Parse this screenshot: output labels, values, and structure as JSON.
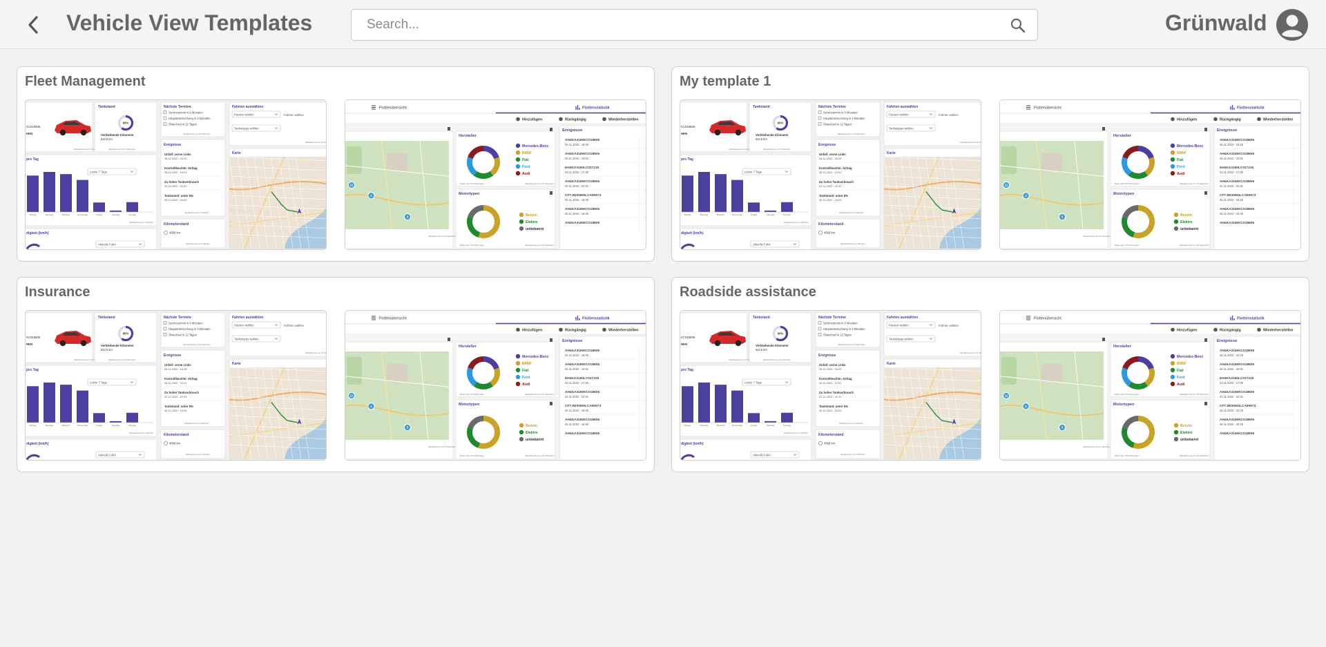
{
  "header": {
    "title": "Vehicle View Templates",
    "search_placeholder": "Search...",
    "org_name": "Grünwald"
  },
  "colors": {
    "accent": "#4b3fa0",
    "header_bg": "#f4f4f4"
  },
  "icons": {
    "back": "chevron-left-icon",
    "search": "search-icon",
    "avatar": "account-circle-icon"
  },
  "templates": [
    {
      "name": "Fleet Management"
    },
    {
      "name": "My template 1"
    },
    {
      "name": "Insurance"
    },
    {
      "name": "Roadside assistance"
    }
  ],
  "preview": {
    "vehicle_id": "KC018606",
    "vehicle_label": "HEN",
    "tank_title": "Tankstand",
    "tank_percent": "60%",
    "remaining_km_label": "Verbleibende Kilometer",
    "remaining_km": "642,5 km",
    "update_10s": "Aktualisierung vor 10 Sekunden",
    "update_15s": "Aktualisierung vor 15 Sekunden",
    "update_20s": "Aktualisierung vor 20 Sekunden",
    "update_2m": "Aktualisierung vor 2 Minuten",
    "appointments_title": "Nächste Termine",
    "appointments": [
      "Servicetermin in 6 Monaten",
      "Hauptuntersuchung in 3 Monaten",
      "Ölwechsel in 12 Tagen"
    ],
    "trips_title": "Fahrten auswählen",
    "pause_select": "Pausen wählen",
    "trips_select": "Fahrten wählen",
    "tankstops_select": "Tankstopps wählen",
    "events_title": "Ereignisse",
    "events": [
      {
        "label": "Unfall: vorne Links",
        "time": "26.11.2022 - 16:25"
      },
      {
        "label": "Kontrollleuchte: Airbag",
        "time": "26.11.2022 - 10:01"
      },
      {
        "label": "Zu hoher Tankverbrauch",
        "time": "22.11.2022 - 22:31"
      },
      {
        "label": "Tankstand: unter 5%",
        "time": "26.11.2022 - 16:25"
      }
    ],
    "per_day_title": "pro Tag",
    "range_select": "Letzte 7 Tage",
    "per_day_chart": {
      "type": "bar",
      "categories": [
        "Montag",
        "Dienstag",
        "Mittwoch",
        "Donnerstag",
        "Freitag",
        "Samstag",
        "Sonntag"
      ],
      "values": [
        100,
        110,
        104,
        88,
        26,
        4,
        27
      ]
    },
    "map_title": "Karte",
    "odometer_title": "Kilometerstand",
    "odometer": "4568 km",
    "speed_title": "digkeit (km/h)",
    "current_trip_select": "Aktuelle Fahrt",
    "tab_overview": "Flottenübersicht",
    "tab_stats": "Flottenstatistik",
    "btn_add": "Hinzufügen",
    "btn_undo": "Rückgängig",
    "btn_redo": "Wiederherstellen",
    "manufacturer_title": "Hersteller",
    "manufacturers": [
      {
        "name": "Mercedes-Benz",
        "color": "#4b3fa0"
      },
      {
        "name": "BMW",
        "color": "#c9a227"
      },
      {
        "name": "Fiat",
        "color": "#1e8a2e"
      },
      {
        "name": "Ford",
        "color": "#2b9be0"
      },
      {
        "name": "Audi",
        "color": "#8b1a1a"
      }
    ],
    "manufacturer_source": "Daten aus 5/9 Fahrzeugen",
    "engine_title": "Motortypen",
    "engines": [
      {
        "name": "Benzin",
        "color": "#c9a227"
      },
      {
        "name": "Elektro",
        "color": "#1e8a2e"
      },
      {
        "name": "unbekannt",
        "color": "#6a6a6a"
      }
    ],
    "engine_source": "Daten aus 7/9 Fahrzeugen",
    "fleet_events_title": "Ereignisse",
    "fleet_events": [
      {
        "id": "AH4KA3160KC018606",
        "time": "26.11.2022 - 16:25"
      },
      {
        "id": "AH4KA3160KC018606",
        "time": "26.11.2022 - 10:01"
      },
      {
        "id": "EH4KA3160LC017215",
        "time": "23.11.2022 - 17:30"
      },
      {
        "id": "AH4KA3160KC018606",
        "time": "22.11.2022 - 22:31"
      },
      {
        "id": "CFTJW30MSLCA90573",
        "time": "26.11.2022 - 16:25"
      },
      {
        "id": "AH4KA3160KC018606",
        "time": "26.11.2022 - 16:25"
      },
      {
        "id": "AH4KA3160KC018606",
        "time": ""
      }
    ]
  }
}
